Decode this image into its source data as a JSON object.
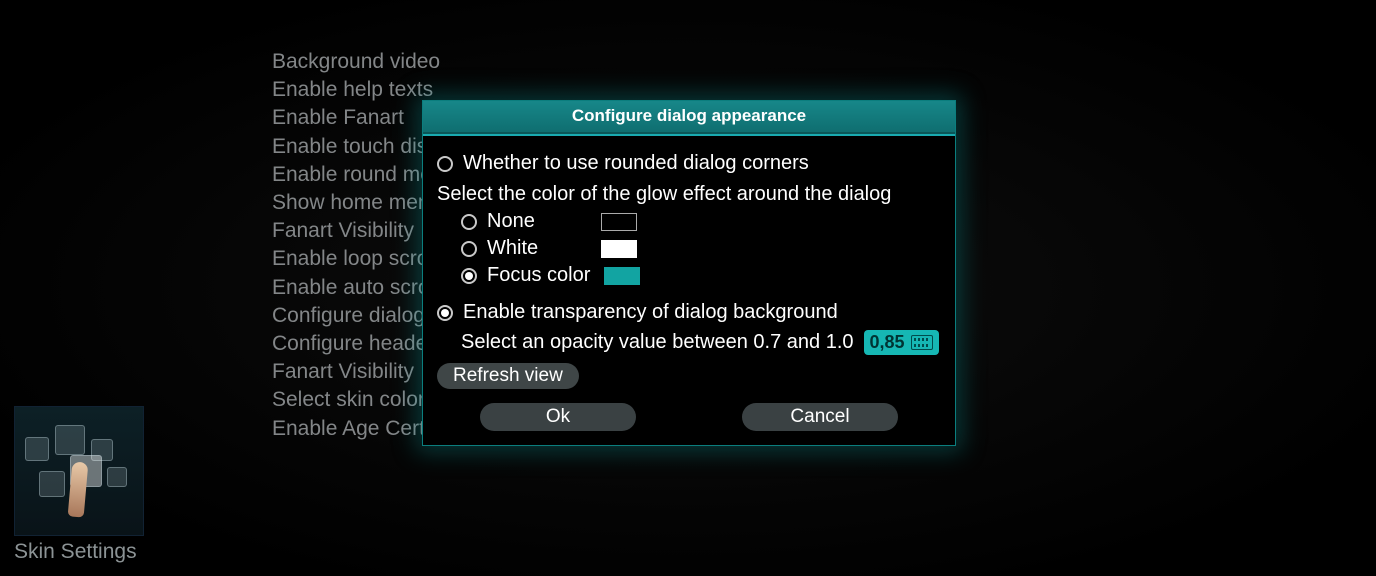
{
  "page_title": "Skin Settings",
  "settings_list": [
    "Background video",
    "Enable help texts",
    "Enable Fanart",
    "Enable touch display support",
    "Enable round menu tiles",
    "Show home menu selection",
    "Fanart Visibility",
    "Enable loop scrolling",
    "Enable auto scrolling",
    "Configure dialog appearance",
    "Configure header appearance",
    "Fanart Visibility",
    "Select skin color scheme",
    "Enable Age Certification Logos"
  ],
  "dialog": {
    "title": "Configure dialog appearance",
    "rounded_corners": {
      "label": "Whether to use rounded dialog corners",
      "checked": false
    },
    "glow": {
      "label": "Select the color of the glow effect around the dialog",
      "options": [
        {
          "label": "None",
          "swatch": "sw-none",
          "checked": false
        },
        {
          "label": "White",
          "swatch": "sw-white",
          "checked": false
        },
        {
          "label": "Focus color",
          "swatch": "sw-focus",
          "checked": true
        }
      ]
    },
    "transparency": {
      "label": "Enable transparency of dialog background",
      "checked": true,
      "opacity_label": "Select an opacity value between 0.7 and 1.0",
      "opacity_value": "0,85"
    },
    "buttons": {
      "refresh": "Refresh view",
      "ok": "Ok",
      "cancel": "Cancel"
    }
  }
}
